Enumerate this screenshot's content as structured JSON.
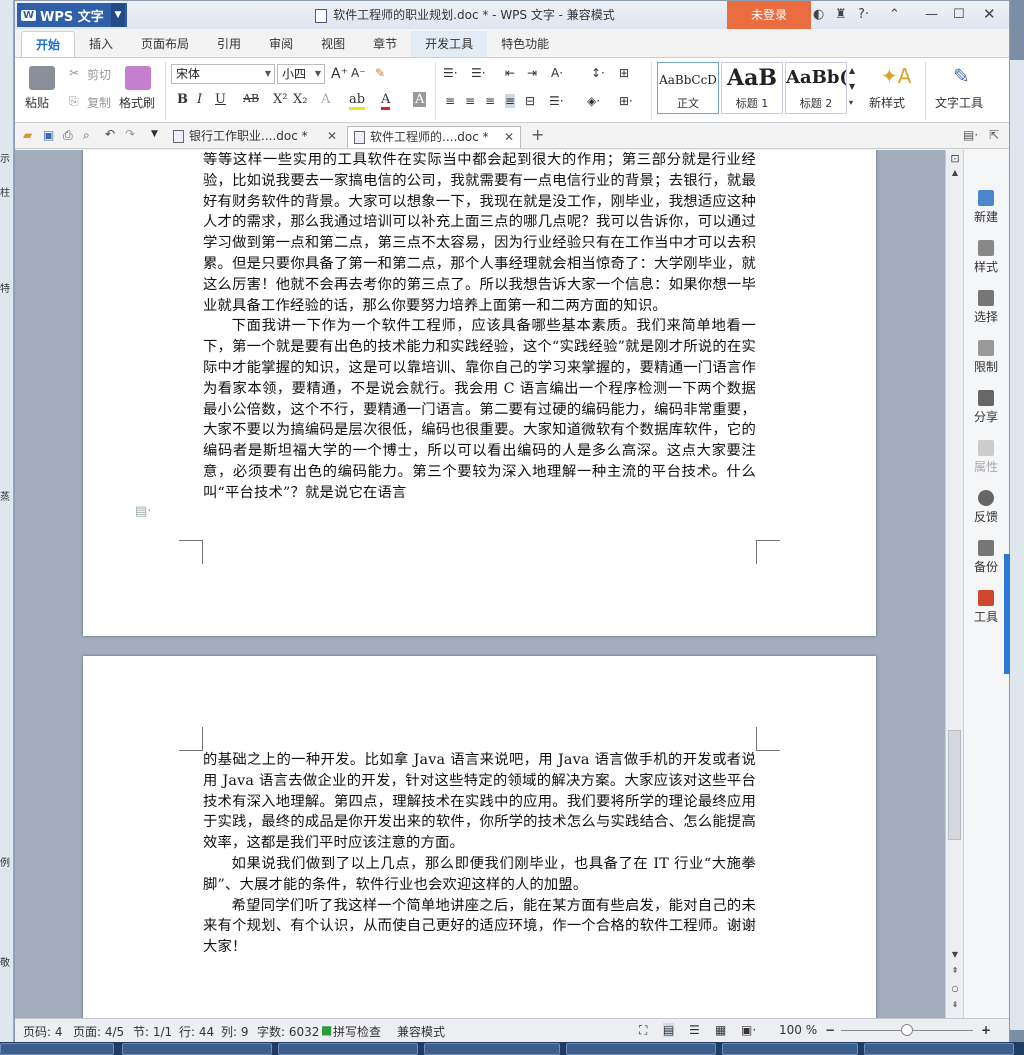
{
  "app": {
    "logo": "WPS 文字",
    "window_title": "软件工程师的职业规划.doc * - WPS 文字 - 兼容模式",
    "login": "未登录"
  },
  "menu_tabs": [
    "开始",
    "插入",
    "页面布局",
    "引用",
    "审阅",
    "视图",
    "章节",
    "开发工具",
    "特色功能"
  ],
  "ribbon": {
    "paste": "粘贴",
    "cut": "剪切",
    "copy": "复制",
    "format_painter": "格式刷",
    "font_name": "宋体",
    "font_size": "小四",
    "styles": [
      {
        "preview": "AaBbCcD",
        "label": "正文"
      },
      {
        "preview": "AaB",
        "label": "标题 1"
      },
      {
        "preview": "AaBb(",
        "label": "标题 2"
      }
    ],
    "new_style": "新样式",
    "text_tools": "文字工具"
  },
  "doc_tabs": [
    {
      "label": "银行工作职业....doc *",
      "active": false
    },
    {
      "label": "软件工程师的....doc *",
      "active": true
    }
  ],
  "page1_paragraphs": [
    {
      "indent": false,
      "text": "等等这样一些实用的工具软件在实际当中都会起到很大的作用；第三部分就是行业经验，比如说我要去一家搞电信的公司，我就需要有一点电信行业的背景；去银行，就最好有财务软件的背景。大家可以想象一下，我现在就是没工作，刚毕业，我想适应这种人才的需求，那么我通过培训可以补充上面三点的哪几点呢？我可以告诉你，可以通过学习做到第一点和第二点，第三点不太容易，因为行业经验只有在工作当中才可以去积累。但是只要你具备了第一和第二点，那个人事经理就会相当惊奇了：大学刚毕业，就这么厉害！他就不会再去考你的第三点了。所以我想告诉大家一个信息：如果你想一毕业就具备工作经验的话，那么你要努力培养上面第一和二两方面的知识。"
    },
    {
      "indent": true,
      "text": "下面我讲一下作为一个软件工程师，应该具备哪些基本素质。我们来简单地看一下，第一个就是要有出色的技术能力和实践经验，这个“实践经验”就是刚才所说的在实际中才能掌握的知识，这是可以靠培训、靠你自己的学习来掌握的，要精通一门语言作为看家本领，要精通，不是说会就行。我会用 C 语言编出一个程序检测一下两个数据最小公倍数，这个不行，要精通一门语言。第二要有过硬的编码能力，编码非常重要，大家不要以为搞编码是层次很低，编码也很重要。大家知道微软有个数据库软件，它的编码者是斯坦福大学的一个博士，所以可以看出编码的人是多么高深。这点大家要注意，必须要有出色的编码能力。第三个要较为深入地理解一种主流的平台技术。什么叫“平台技术”？就是说它在语言"
    }
  ],
  "page2_paragraphs": [
    {
      "indent": false,
      "text": "的基础之上的一种开发。比如拿 Java 语言来说吧，用 Java 语言做手机的开发或者说用 Java 语言去做企业的开发，针对这些特定的领域的解决方案。大家应该对这些平台技术有深入地理解。第四点，理解技术在实践中的应用。我们要将所学的理论最终应用于实践，最终的成品是你开发出来的软件，你所学的技术怎么与实践结合、怎么能提高效率，这都是我们平时应该注意的方面。"
    },
    {
      "indent": true,
      "text": "如果说我们做到了以上几点，那么即便我们刚毕业，也具备了在 IT 行业“大施拳脚”、大展才能的条件，软件行业也会欢迎这样的人的加盟。"
    },
    {
      "indent": true,
      "text": "希望同学们听了我这样一个简单地讲座之后，能在某方面有些启发，能对自己的未来有个规划、有个认识，从而使自己更好的适应环境，作一个合格的软件工程师。谢谢大家！"
    }
  ],
  "right_panel": [
    {
      "label": "新建",
      "enabled": true
    },
    {
      "label": "样式",
      "enabled": true
    },
    {
      "label": "选择",
      "enabled": true
    },
    {
      "label": "限制",
      "enabled": true
    },
    {
      "label": "分享",
      "enabled": true
    },
    {
      "label": "属性",
      "enabled": false
    },
    {
      "label": "反馈",
      "enabled": true
    },
    {
      "label": "备份",
      "enabled": true
    },
    {
      "label": "工具",
      "enabled": true
    }
  ],
  "status": {
    "page_num": "页码: 4",
    "pages": "页面: 4/5",
    "section": "节: 1/1",
    "line": "行: 44",
    "col": "列: 9",
    "word_count": "字数: 6032",
    "spellcheck": "拼写检查",
    "compat": "兼容模式",
    "zoom": "100 %"
  },
  "left_edge_labels": [
    "示",
    "柱",
    "特",
    "蒸",
    "例",
    "敬"
  ],
  "colors": {
    "accent": "#1d6ec5",
    "login_bg": "#e96d3e",
    "logo_bg": "#2f5fa8"
  }
}
